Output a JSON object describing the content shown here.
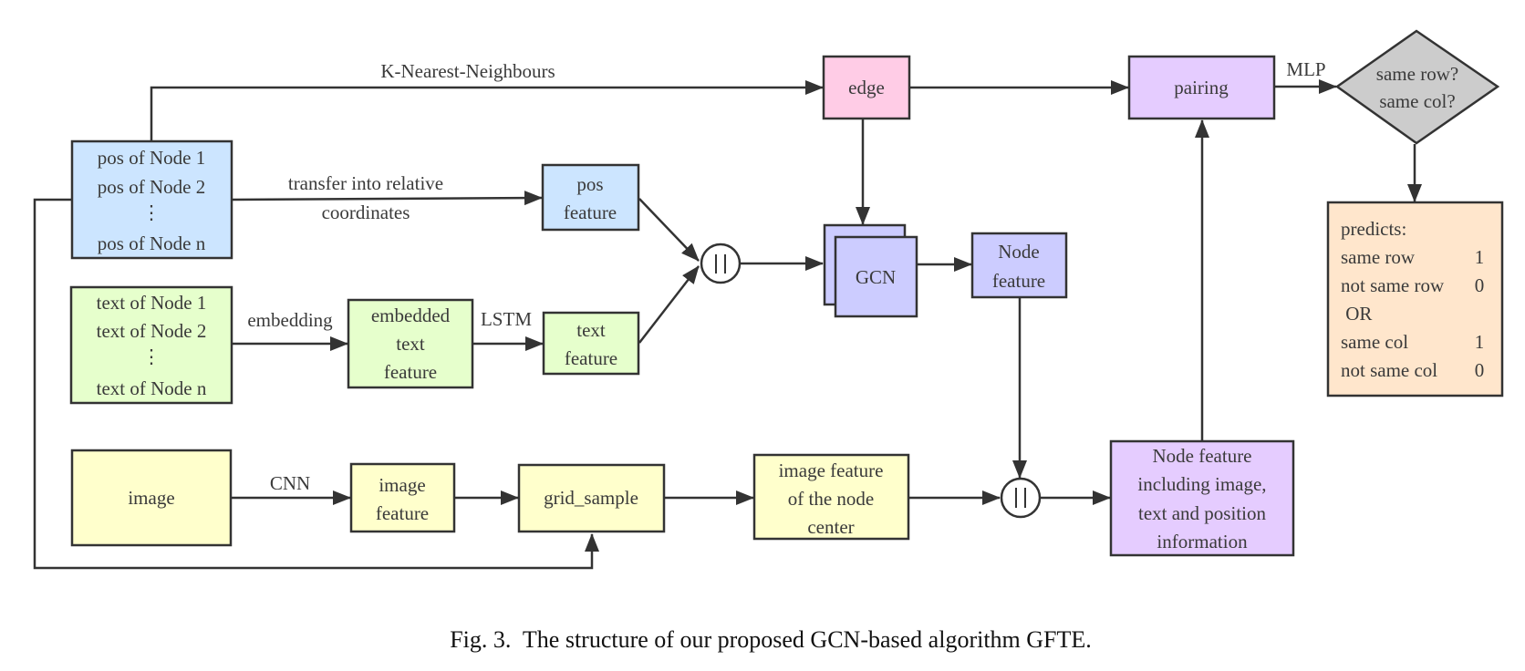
{
  "figure": {
    "caption": "Fig. 3.  The structure of our proposed GCN-based algorithm GFTE.",
    "colors": {
      "pos": "#cce5ff",
      "text": "#e6ffcc",
      "image": "#ffffcc",
      "edge": "#ffcce6",
      "gcn": "#ccccff",
      "pairing": "#e5ccff",
      "decision": "#cccccc",
      "predicts": "#ffe6cc",
      "stroke": "#333333"
    }
  },
  "nodes": {
    "pos_input": {
      "lines": [
        "pos of Node 1",
        "pos of Node 2",
        "⋮",
        "pos of Node n"
      ]
    },
    "text_input": {
      "lines": [
        "text of Node 1",
        "text of Node 2",
        "⋮",
        "text of Node n"
      ]
    },
    "image_input": {
      "lines": [
        "image"
      ]
    },
    "pos_feature": {
      "lines": [
        "pos",
        "feature"
      ]
    },
    "embedded_text_feature": {
      "lines": [
        "embedded",
        "text",
        "feature"
      ]
    },
    "text_feature": {
      "lines": [
        "text",
        "feature"
      ]
    },
    "image_feature": {
      "lines": [
        "image",
        "feature"
      ]
    },
    "grid_sample": {
      "lines": [
        "grid_sample"
      ]
    },
    "image_feature_node_center": {
      "lines": [
        "image feature",
        "of the node",
        "center"
      ]
    },
    "edge": {
      "lines": [
        "edge"
      ]
    },
    "gcn": {
      "lines": [
        "GCN"
      ]
    },
    "node_feature": {
      "lines": [
        "Node",
        "feature"
      ]
    },
    "concat_1": {
      "symbol": "||"
    },
    "concat_2": {
      "symbol": "||"
    },
    "combined_node_feature": {
      "lines": [
        "Node feature",
        "including image,",
        "text and position",
        "information"
      ]
    },
    "pairing": {
      "lines": [
        "pairing"
      ]
    },
    "decision": {
      "lines": [
        "same row?",
        "same col?"
      ]
    },
    "predicts": {
      "title": "predicts:",
      "rows": [
        {
          "label": "same row",
          "value": "1"
        },
        {
          "label": "not same row",
          "value": "0"
        },
        {
          "label": " OR",
          "value": ""
        },
        {
          "label": "same col",
          "value": "1"
        },
        {
          "label": "not same col",
          "value": "0"
        }
      ]
    }
  },
  "edge_labels": {
    "knn": "K-Nearest-Neighbours",
    "relative_1": "transfer into relative",
    "relative_2": "coordinates",
    "embedding": "embedding",
    "lstm": "LSTM",
    "cnn": "CNN",
    "mlp": "MLP"
  }
}
